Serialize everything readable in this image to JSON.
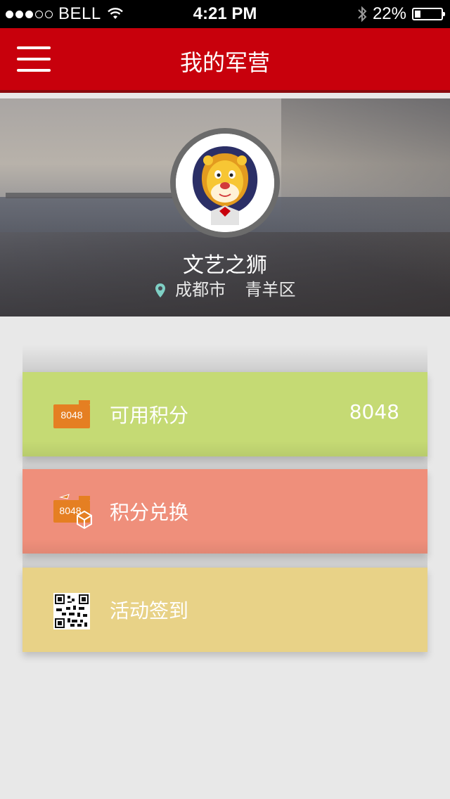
{
  "status_bar": {
    "carrier": "BELL",
    "time": "4:21 PM",
    "battery_percent": "22%",
    "battery_level": 0.22,
    "signal_bars_filled": 3,
    "signal_bars_total": 5
  },
  "nav": {
    "title": "我的军营",
    "menu_icon": "hamburger-menu-icon"
  },
  "profile": {
    "name": "文艺之狮",
    "city": "成都市",
    "district": "青羊区",
    "location_icon": "map-pin-icon",
    "avatar_icon": "lion-avatar"
  },
  "cards": [
    {
      "label": "可用积分",
      "value": "8048",
      "icon": "points-box-icon",
      "icon_text": "8048",
      "color": "#c5da74"
    },
    {
      "label": "积分兑换",
      "icon": "points-exchange-icon",
      "icon_text": "8048",
      "color": "#ef8f7b"
    },
    {
      "label": "活动签到",
      "icon": "qr-code-icon",
      "color": "#e8d287"
    }
  ],
  "colors": {
    "nav_red": "#c8000c",
    "background": "#e8e8e8"
  }
}
